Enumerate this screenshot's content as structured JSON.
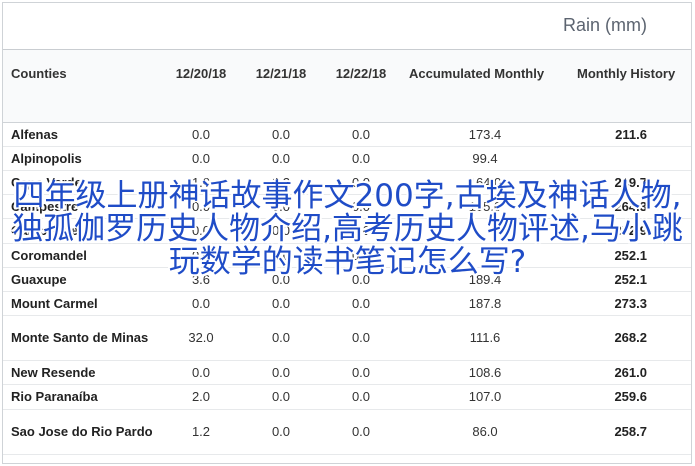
{
  "header": {
    "title": "Rain (mm)"
  },
  "table": {
    "columns": [
      "Counties",
      "12/20/18",
      "12/21/18",
      "12/22/18",
      "Accumulated Monthly",
      "Monthly History"
    ],
    "rows": [
      [
        "Alfenas",
        "0.0",
        "0.0",
        "0.0",
        "173.4",
        "211.6"
      ],
      [
        "Alpinopolis",
        "0.0",
        "0.0",
        "0.0",
        "99.4",
        ""
      ],
      [
        "Cape Verde",
        "1.0",
        "0.2",
        "0.0",
        "164.0",
        "249.7"
      ],
      [
        "Campestre",
        "0.0",
        "0.0",
        "0.0",
        "155.0",
        "264.3"
      ],
      [
        "Campestre",
        "0.0",
        "0.0",
        "0.0",
        "",
        "252.9"
      ],
      [
        "Coromandel",
        "0.0",
        "0.0",
        "0.0",
        "",
        "252.1"
      ],
      [
        "Guaxupe",
        "3.6",
        "0.0",
        "0.0",
        "189.4",
        "252.1"
      ],
      [
        "Mount Carmel",
        "0.0",
        "0.0",
        "0.0",
        "187.8",
        "273.3"
      ],
      [
        "Monte Santo de Minas",
        "32.0",
        "0.0",
        "0.0",
        "111.6",
        "268.2"
      ],
      [
        "New Resende",
        "0.0",
        "0.0",
        "0.0",
        "108.6",
        "261.0"
      ],
      [
        "Rio Paranaíba",
        "2.0",
        "0.0",
        "0.0",
        "107.0",
        "259.6"
      ],
      [
        "Sao Jose do Rio Pardo",
        "1.2",
        "0.0",
        "0.0",
        "86.0",
        "258.7"
      ]
    ]
  },
  "overlay": {
    "text": "四年级上册神话故事作文200字,古埃及神话人物,独孤伽罗历史人物介绍,高考历史人物评述,马小跳玩数学的读书笔记怎么写?"
  }
}
